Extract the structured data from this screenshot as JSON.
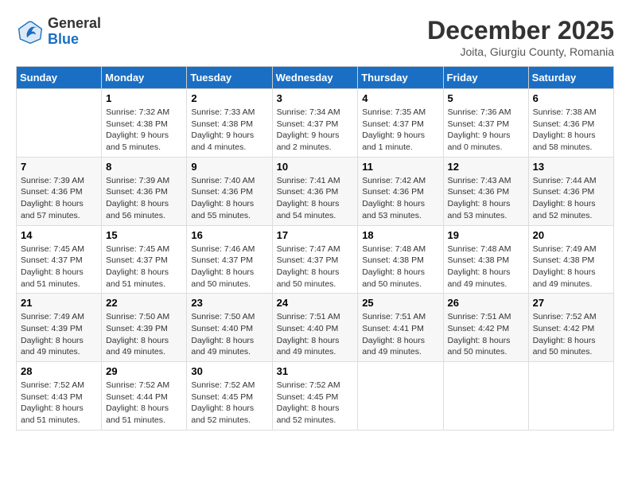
{
  "header": {
    "logo_general": "General",
    "logo_blue": "Blue",
    "month_title": "December 2025",
    "location": "Joita, Giurgiu County, Romania"
  },
  "days_of_week": [
    "Sunday",
    "Monday",
    "Tuesday",
    "Wednesday",
    "Thursday",
    "Friday",
    "Saturday"
  ],
  "weeks": [
    [
      {
        "day": "",
        "info": ""
      },
      {
        "day": "1",
        "info": "Sunrise: 7:32 AM\nSunset: 4:38 PM\nDaylight: 9 hours\nand 5 minutes."
      },
      {
        "day": "2",
        "info": "Sunrise: 7:33 AM\nSunset: 4:38 PM\nDaylight: 9 hours\nand 4 minutes."
      },
      {
        "day": "3",
        "info": "Sunrise: 7:34 AM\nSunset: 4:37 PM\nDaylight: 9 hours\nand 2 minutes."
      },
      {
        "day": "4",
        "info": "Sunrise: 7:35 AM\nSunset: 4:37 PM\nDaylight: 9 hours\nand 1 minute."
      },
      {
        "day": "5",
        "info": "Sunrise: 7:36 AM\nSunset: 4:37 PM\nDaylight: 9 hours\nand 0 minutes."
      },
      {
        "day": "6",
        "info": "Sunrise: 7:38 AM\nSunset: 4:36 PM\nDaylight: 8 hours\nand 58 minutes."
      }
    ],
    [
      {
        "day": "7",
        "info": "Sunrise: 7:39 AM\nSunset: 4:36 PM\nDaylight: 8 hours\nand 57 minutes."
      },
      {
        "day": "8",
        "info": "Sunrise: 7:39 AM\nSunset: 4:36 PM\nDaylight: 8 hours\nand 56 minutes."
      },
      {
        "day": "9",
        "info": "Sunrise: 7:40 AM\nSunset: 4:36 PM\nDaylight: 8 hours\nand 55 minutes."
      },
      {
        "day": "10",
        "info": "Sunrise: 7:41 AM\nSunset: 4:36 PM\nDaylight: 8 hours\nand 54 minutes."
      },
      {
        "day": "11",
        "info": "Sunrise: 7:42 AM\nSunset: 4:36 PM\nDaylight: 8 hours\nand 53 minutes."
      },
      {
        "day": "12",
        "info": "Sunrise: 7:43 AM\nSunset: 4:36 PM\nDaylight: 8 hours\nand 53 minutes."
      },
      {
        "day": "13",
        "info": "Sunrise: 7:44 AM\nSunset: 4:36 PM\nDaylight: 8 hours\nand 52 minutes."
      }
    ],
    [
      {
        "day": "14",
        "info": "Sunrise: 7:45 AM\nSunset: 4:37 PM\nDaylight: 8 hours\nand 51 minutes."
      },
      {
        "day": "15",
        "info": "Sunrise: 7:45 AM\nSunset: 4:37 PM\nDaylight: 8 hours\nand 51 minutes."
      },
      {
        "day": "16",
        "info": "Sunrise: 7:46 AM\nSunset: 4:37 PM\nDaylight: 8 hours\nand 50 minutes."
      },
      {
        "day": "17",
        "info": "Sunrise: 7:47 AM\nSunset: 4:37 PM\nDaylight: 8 hours\nand 50 minutes."
      },
      {
        "day": "18",
        "info": "Sunrise: 7:48 AM\nSunset: 4:38 PM\nDaylight: 8 hours\nand 50 minutes."
      },
      {
        "day": "19",
        "info": "Sunrise: 7:48 AM\nSunset: 4:38 PM\nDaylight: 8 hours\nand 49 minutes."
      },
      {
        "day": "20",
        "info": "Sunrise: 7:49 AM\nSunset: 4:38 PM\nDaylight: 8 hours\nand 49 minutes."
      }
    ],
    [
      {
        "day": "21",
        "info": "Sunrise: 7:49 AM\nSunset: 4:39 PM\nDaylight: 8 hours\nand 49 minutes."
      },
      {
        "day": "22",
        "info": "Sunrise: 7:50 AM\nSunset: 4:39 PM\nDaylight: 8 hours\nand 49 minutes."
      },
      {
        "day": "23",
        "info": "Sunrise: 7:50 AM\nSunset: 4:40 PM\nDaylight: 8 hours\nand 49 minutes."
      },
      {
        "day": "24",
        "info": "Sunrise: 7:51 AM\nSunset: 4:40 PM\nDaylight: 8 hours\nand 49 minutes."
      },
      {
        "day": "25",
        "info": "Sunrise: 7:51 AM\nSunset: 4:41 PM\nDaylight: 8 hours\nand 49 minutes."
      },
      {
        "day": "26",
        "info": "Sunrise: 7:51 AM\nSunset: 4:42 PM\nDaylight: 8 hours\nand 50 minutes."
      },
      {
        "day": "27",
        "info": "Sunrise: 7:52 AM\nSunset: 4:42 PM\nDaylight: 8 hours\nand 50 minutes."
      }
    ],
    [
      {
        "day": "28",
        "info": "Sunrise: 7:52 AM\nSunset: 4:43 PM\nDaylight: 8 hours\nand 51 minutes."
      },
      {
        "day": "29",
        "info": "Sunrise: 7:52 AM\nSunset: 4:44 PM\nDaylight: 8 hours\nand 51 minutes."
      },
      {
        "day": "30",
        "info": "Sunrise: 7:52 AM\nSunset: 4:45 PM\nDaylight: 8 hours\nand 52 minutes."
      },
      {
        "day": "31",
        "info": "Sunrise: 7:52 AM\nSunset: 4:45 PM\nDaylight: 8 hours\nand 52 minutes."
      },
      {
        "day": "",
        "info": ""
      },
      {
        "day": "",
        "info": ""
      },
      {
        "day": "",
        "info": ""
      }
    ]
  ]
}
